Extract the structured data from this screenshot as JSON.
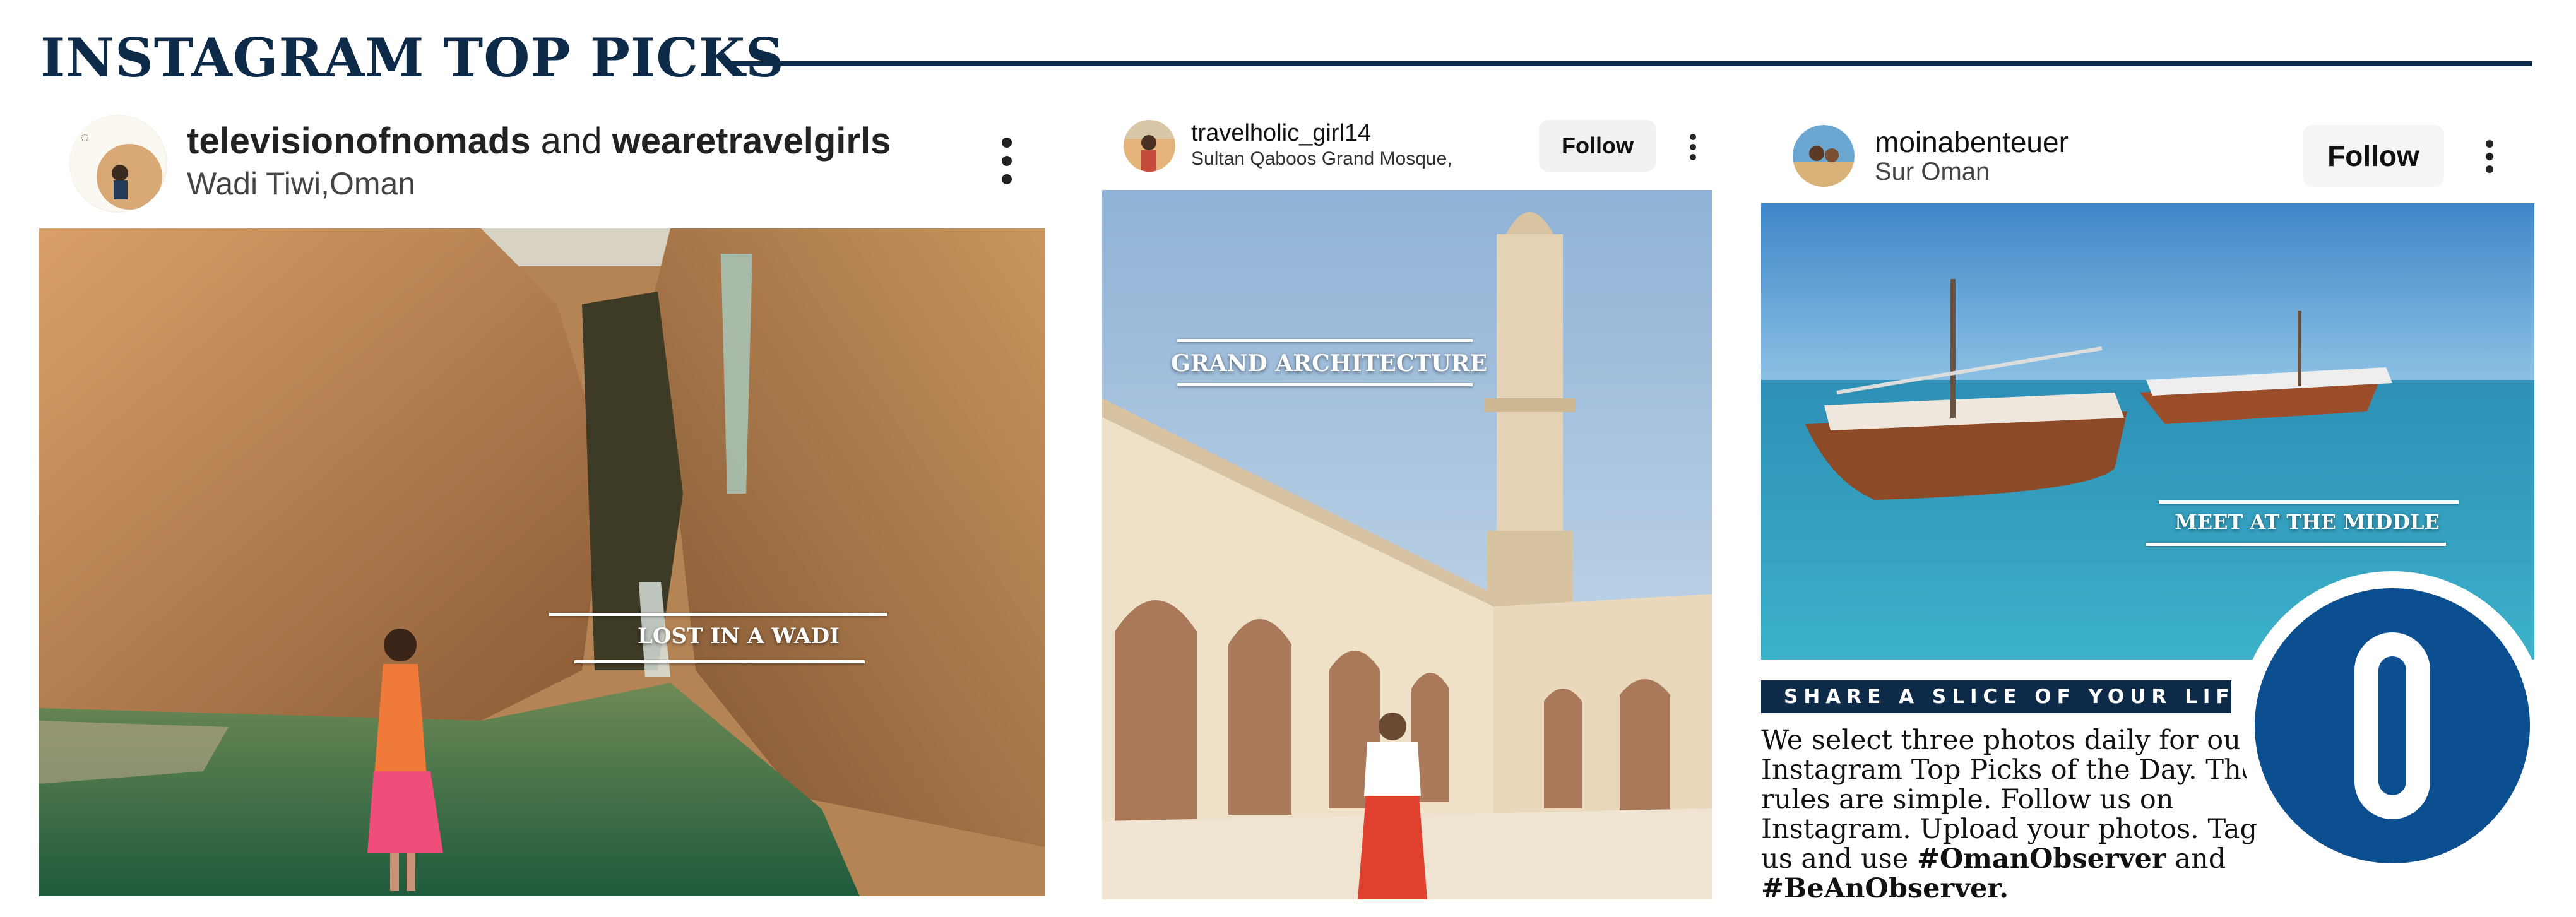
{
  "section": {
    "title": "INSTAGRAM TOP PICKS"
  },
  "posts": [
    {
      "username": "televisionofnomads",
      "connector": " and ",
      "coauthor": "wearetravelgirls",
      "location": "Wadi Tiwi,Oman",
      "caption": "LOST IN A WADI"
    },
    {
      "username": "travelholic_girl14",
      "location": "Sultan Qaboos Grand Mosque,",
      "follow_label": "Follow",
      "caption": "GRAND ARCHITECTURE"
    },
    {
      "username": "moinabenteuer",
      "location": "Sur Oman",
      "follow_label": "Follow",
      "caption": "MEET AT THE MIDDLE"
    }
  ],
  "share": {
    "banner": "SHARE A SLICE OF YOUR LIFE",
    "body": "We select three photos daily for our Instagram Top Picks of the Day. The rules are simple. Follow us on Instagram. Upload your photos. Tag us and use",
    "tag1": "#OmanObserver",
    "and": "and",
    "tag2": "#BeAnObserver."
  },
  "logo": {
    "letter": "O"
  },
  "colors": {
    "navy": "#0d2a48",
    "logo_blue": "#0b4f91"
  }
}
